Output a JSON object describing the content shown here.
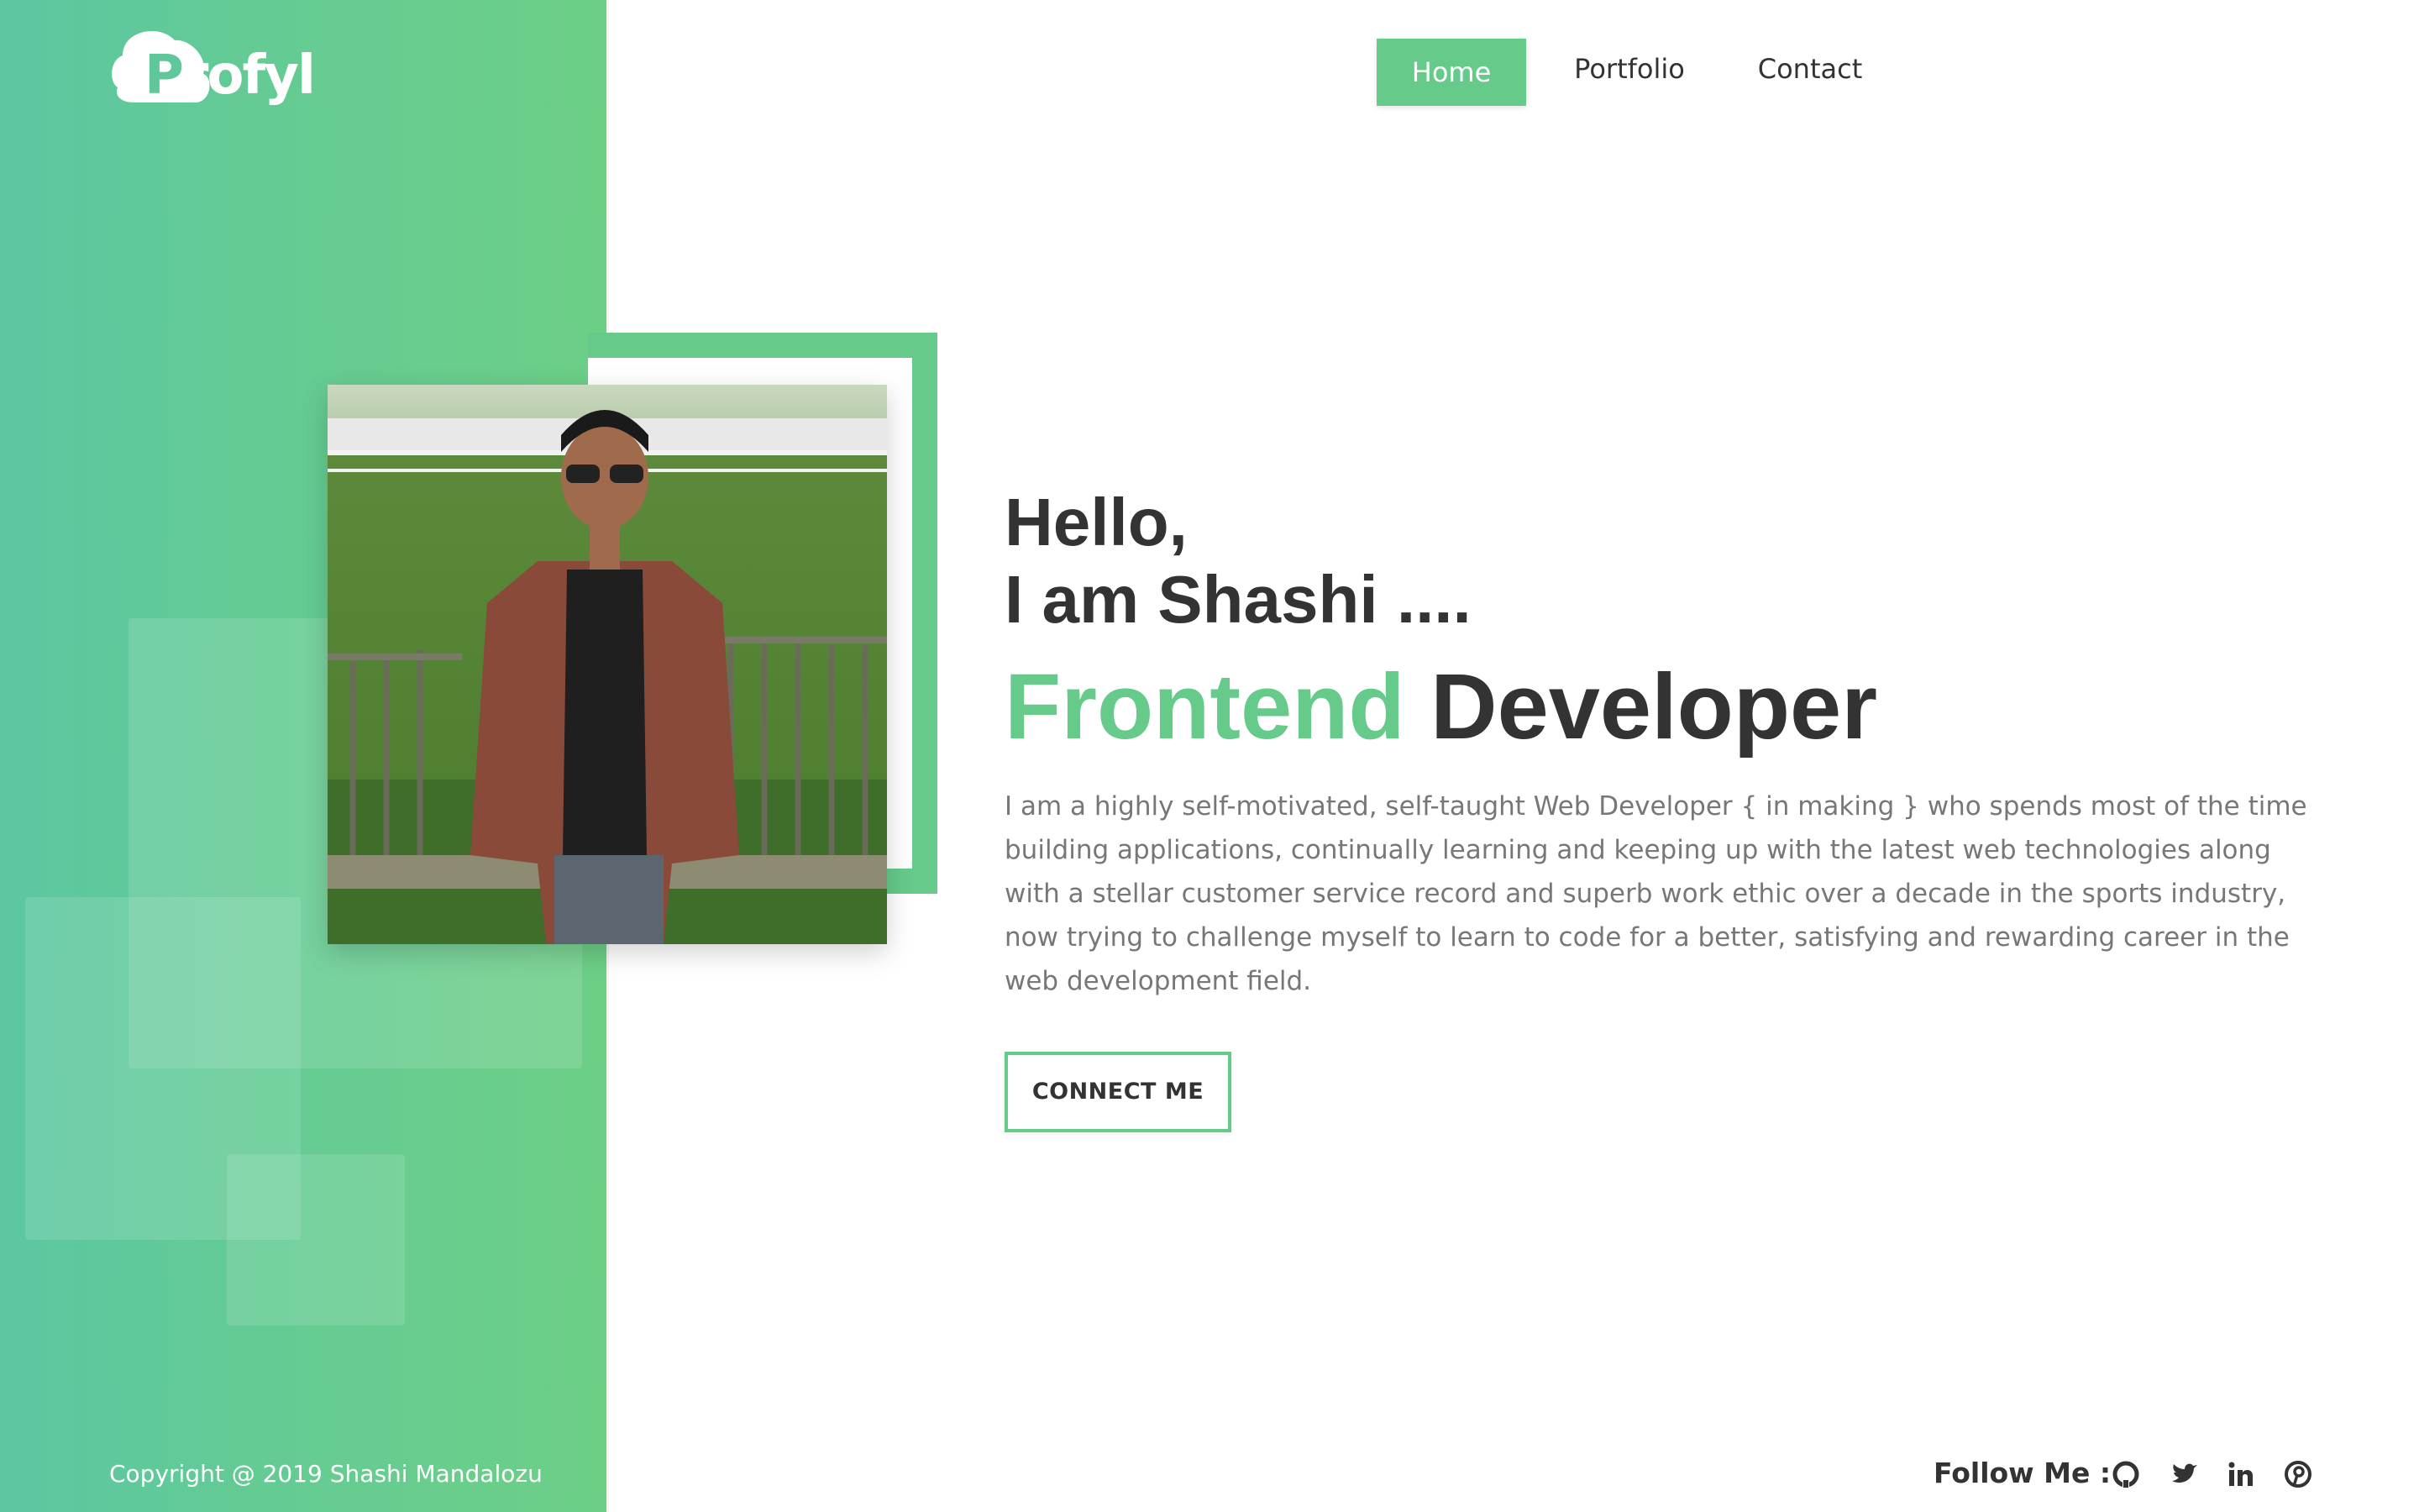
{
  "brand": {
    "logo_text": "Profyl",
    "accent_color": "#66ca8b",
    "sidebar_color": "#62c993"
  },
  "nav": {
    "items": [
      {
        "label": "Home",
        "active": true
      },
      {
        "label": "Portfolio",
        "active": false
      },
      {
        "label": "Contact",
        "active": false
      }
    ]
  },
  "hero": {
    "greeting_line1": "Hello,",
    "greeting_line2": "I am Shashi ....",
    "role_accent": "Frontend",
    "role_rest": "Developer",
    "bio": "I am a highly self-motivated, self-taught Web Developer { in making } who spends most of the time building applications, continually learning and keeping up with the latest web technologies along with a stellar customer service record and superb work ethic over a decade in the sports industry, now trying to challenge myself to learn to code for a better, satisfying and rewarding career in the web development field.",
    "cta_label": "CONNECT ME"
  },
  "footer": {
    "copyright": "Copyright @ 2019 Shashi Mandalozu",
    "follow_label": "Follow Me :",
    "social_icons": [
      "github-icon",
      "twitter-icon",
      "linkedin-icon",
      "pinterest-icon"
    ]
  }
}
